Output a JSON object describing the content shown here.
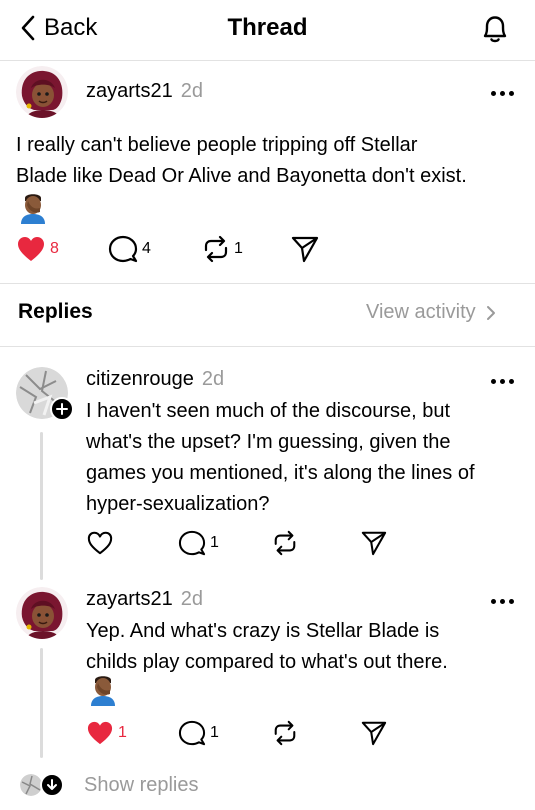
{
  "nav": {
    "back_label": "Back",
    "title": "Thread",
    "back_icon": "chevron-left-icon",
    "bell_icon": "bell-icon"
  },
  "main_post": {
    "username": "zayarts21",
    "time": "2d",
    "text_lines": [
      "I really can't believe people tripping off Stellar",
      "Blade like Dead Or Alive and Bayonetta don't exist."
    ],
    "emoji": "man-facepalming-emoji",
    "likes": "8",
    "comments": "4",
    "reposts": "1",
    "liked": true
  },
  "replies_header": {
    "title": "Replies",
    "view_activity": "View activity"
  },
  "replies": [
    {
      "username": "citizenrouge",
      "time": "2d",
      "text_lines": [
        "I haven't seen much of the discourse, but",
        "what's the upset? I'm guessing, given the",
        "games you mentioned, it's along the lines of",
        "hyper-sexualization?"
      ],
      "likes": "",
      "comments": "1",
      "reposts": "",
      "liked": false
    },
    {
      "username": "zayarts21",
      "time": "2d",
      "text_lines": [
        "Yep. And what's crazy is Stellar Blade is",
        "childs play compared to what's out there."
      ],
      "emoji": "man-facepalming-emoji",
      "likes": "1",
      "comments": "1",
      "reposts": "",
      "liked": true
    }
  ],
  "show_replies": "Show replies",
  "colors": {
    "like_red": "#e8283f",
    "muted": "#9a9a9a",
    "divider": "#e2e2e2"
  }
}
